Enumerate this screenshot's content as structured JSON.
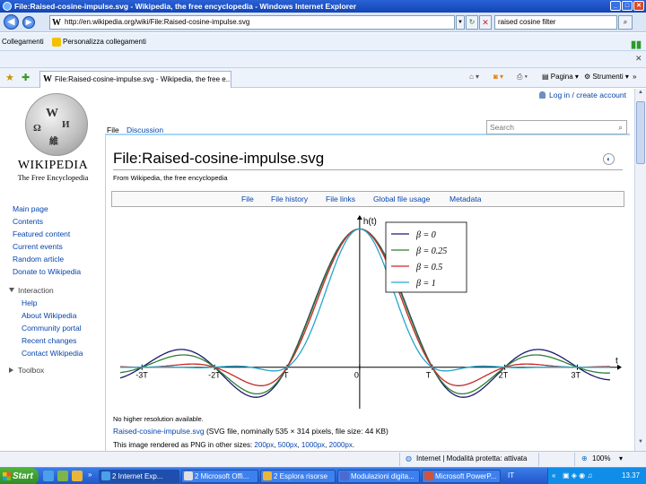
{
  "window": {
    "title": "File:Raised-cosine-impulse.svg - Wikipedia, the free encyclopedia - Windows Internet Explorer"
  },
  "addressbar": {
    "url": "http://en.wikipedia.org/wiki/File:Raised-cosine-impulse.svg",
    "search_value": "raised cosine filter"
  },
  "linksbar": {
    "items": [
      "Collegamenti",
      "Personalizza collegamenti"
    ]
  },
  "tabbar": {
    "tab_title": "File:Raised-cosine-impulse.svg - Wikipedia, the free e...",
    "commands": [
      "Pagina",
      "Strumenti"
    ]
  },
  "wiki": {
    "wordmark": "WIKIPEDIA",
    "tagline": "The Free Encyclopedia",
    "login": "Log in / create account",
    "page_tabs": [
      "File",
      "Discussion"
    ],
    "search_placeholder": "Search",
    "nav": [
      "Main page",
      "Contents",
      "Featured content",
      "Current events",
      "Random article",
      "Donate to Wikipedia"
    ],
    "interaction_heading": "Interaction",
    "interaction": [
      "Help",
      "About Wikipedia",
      "Community portal",
      "Recent changes",
      "Contact Wikipedia"
    ],
    "toolbox_heading": "Toolbox",
    "title": "File:Raised-cosine-impulse.svg",
    "from": "From Wikipedia, the free encyclopedia",
    "file_tabs": [
      "File",
      "File history",
      "File links",
      "Global file usage",
      "Metadata"
    ],
    "no_higher": "No higher resolution available.",
    "file_link": "Raised-cosine-impulse.svg",
    "file_info": "(SVG file, nominally 535 × 314 pixels, file size: 44 KB)",
    "rendered_prefix": "This image rendered as PNG in other sizes:",
    "rendered_sizes": [
      "200px",
      "500px",
      "1000px",
      "2000px"
    ]
  },
  "chart_data": {
    "type": "line",
    "ylabel": "h(t)",
    "xlabel": "t",
    "x_ticks": [
      "-3T",
      "-2T",
      "-T",
      "0",
      "T",
      "2T",
      "3T"
    ],
    "xlim": [
      -3.3,
      3.6
    ],
    "ylim": [
      -0.3,
      1.1
    ],
    "legend_position": "top-right",
    "series": [
      {
        "name": "β = 0",
        "beta": 0,
        "color": "#1a1a70"
      },
      {
        "name": "β = 0.25",
        "beta": 0.25,
        "color": "#2e7d32"
      },
      {
        "name": "β = 0.5",
        "beta": 0.5,
        "color": "#c62828"
      },
      {
        "name": "β = 1",
        "beta": 1,
        "color": "#26a6c9"
      }
    ]
  },
  "statusbar": {
    "zone": "Internet | Modalità protetta: attivata",
    "zoom": "100%"
  },
  "taskbar": {
    "start": "Start",
    "tasks": [
      "2 Internet Exp...",
      "2 Microsoft Offi...",
      "2 Esplora risorse",
      "Modulazioni digita...",
      "Microsoft PowerP..."
    ],
    "lang": "IT",
    "clock": "13.37"
  }
}
